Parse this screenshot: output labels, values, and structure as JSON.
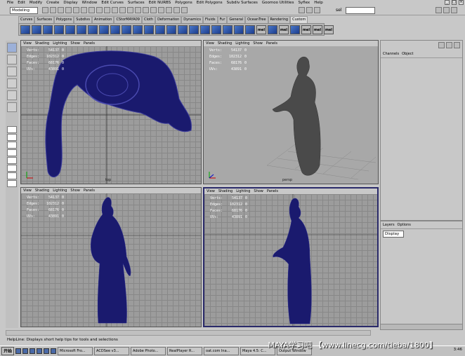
{
  "menubar": {
    "items": [
      "File",
      "Edit",
      "Modify",
      "Create",
      "Display",
      "Window",
      "Edit Curves",
      "Surfaces",
      "Edit NURBS",
      "Polygons",
      "Edit Polygons",
      "Subdiv Surfaces",
      "Goomoo Utilities",
      "Syflex",
      "Help"
    ]
  },
  "statusline": {
    "mode": "Modeling",
    "sel_label": "sel",
    "sel_value": ""
  },
  "shelf": {
    "tabs": [
      "Curves",
      "Surfaces",
      "Polygons",
      "Subdivs",
      "Animation",
      "CStorMAYA09",
      "Cloth",
      "Deformation",
      "Dynamics",
      "Fluids",
      "Fur",
      "General",
      "OceanTree",
      "Rendering",
      "Custom"
    ],
    "active_tab": "Custom",
    "mel_labels": [
      "mel",
      "mel",
      "mel",
      "mel",
      "mel"
    ]
  },
  "viewports": [
    {
      "menu": [
        "View",
        "Shading",
        "Lighting",
        "Show",
        "Panels"
      ],
      "hud": [
        {
          "k": "Verts:",
          "v": "54137",
          "z": "0"
        },
        {
          "k": "Edges:",
          "v": "102312",
          "z": "0"
        },
        {
          "k": "Faces:",
          "v": "68176",
          "z": "0"
        },
        {
          "k": "UVs:",
          "v": "43891",
          "z": "0"
        }
      ],
      "camera": "top"
    },
    {
      "menu": [
        "View",
        "Shading",
        "Lighting",
        "Show",
        "Panels"
      ],
      "hud": [
        {
          "k": "Verts:",
          "v": "54137",
          "z": "0"
        },
        {
          "k": "Edges:",
          "v": "102312",
          "z": "0"
        },
        {
          "k": "Faces:",
          "v": "68176",
          "z": "0"
        },
        {
          "k": "UVs:",
          "v": "43891",
          "z": "0"
        }
      ],
      "camera": "persp"
    },
    {
      "menu": [
        "View",
        "Shading",
        "Lighting",
        "Show",
        "Panels"
      ],
      "hud": [
        {
          "k": "Verts:",
          "v": "54137",
          "z": "0"
        },
        {
          "k": "Edges:",
          "v": "102312",
          "z": "0"
        },
        {
          "k": "Faces:",
          "v": "68176",
          "z": "0"
        },
        {
          "k": "UVs:",
          "v": "43891",
          "z": "0"
        }
      ],
      "camera": ""
    },
    {
      "menu": [
        "View",
        "Shading",
        "Lighting",
        "Show",
        "Panels"
      ],
      "hud": [
        {
          "k": "Verts:",
          "v": "54137",
          "z": "0"
        },
        {
          "k": "Edges:",
          "v": "102312",
          "z": "0"
        },
        {
          "k": "Faces:",
          "v": "68176",
          "z": "0"
        },
        {
          "k": "UVs:",
          "v": "43891",
          "z": "0"
        }
      ],
      "camera": ""
    }
  ],
  "channelbox": {
    "tabs": [
      "Channels",
      "Object"
    ]
  },
  "layers": {
    "tabs": [
      "Layers",
      "Options"
    ],
    "display": "Display"
  },
  "helpline": "HelpLine: Displays short help tips for tools and selections",
  "taskbar": {
    "start": "开始",
    "tasks": [
      "Microsoft Fro...",
      "ACDSee v3...",
      "Adobe Photo...",
      "RealPlayer R...",
      "oat.com Ina...",
      "Maya 4.5: C...",
      "Output Window"
    ]
  },
  "watermark": "MAYA学习吧 【www.linecg.com/tieba/1800】",
  "clock": "3:46",
  "colors": {
    "mesh": "#1a1a6e",
    "statue_persp": "#4a4a4a",
    "grid_bg": "#9c9c9c",
    "active_border": "#2a2a6a"
  }
}
